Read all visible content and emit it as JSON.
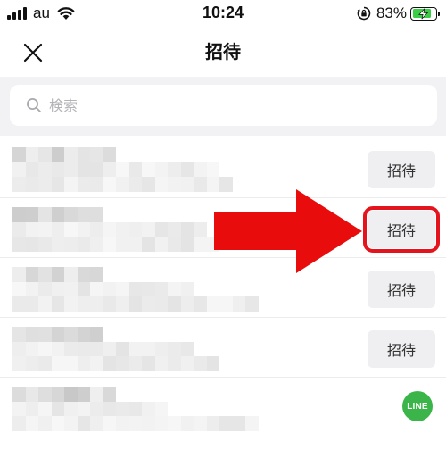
{
  "status_bar": {
    "carrier": "au",
    "time": "10:24",
    "battery_percent": "83%",
    "battery_level": 0.83,
    "icons": [
      "cellular-signal-icon",
      "wifi-icon",
      "rotation-lock-icon",
      "battery-charging-icon"
    ]
  },
  "nav": {
    "title": "招待",
    "close_icon": "close-icon"
  },
  "search": {
    "placeholder": "検索",
    "value": "",
    "icon": "search-icon"
  },
  "friends": [
    {
      "invite_label": "招待",
      "highlighted": false,
      "blurred": true
    },
    {
      "invite_label": "招待",
      "highlighted": true,
      "blurred": true
    },
    {
      "invite_label": "招待",
      "highlighted": false,
      "blurred": true
    },
    {
      "invite_label": "招待",
      "highlighted": false,
      "blurred": true
    },
    {
      "invite_label": "",
      "highlighted": false,
      "blurred": true
    }
  ],
  "annotation": {
    "arrow_color": "#e80c0c",
    "highlight_color": "#e3141d"
  },
  "watermark": {
    "text": "LINE",
    "color": "#3bb54a"
  },
  "colors": {
    "search_background": "#f2f2f4",
    "button_background": "#efeff2",
    "battery_fill": "#3ccd47"
  }
}
